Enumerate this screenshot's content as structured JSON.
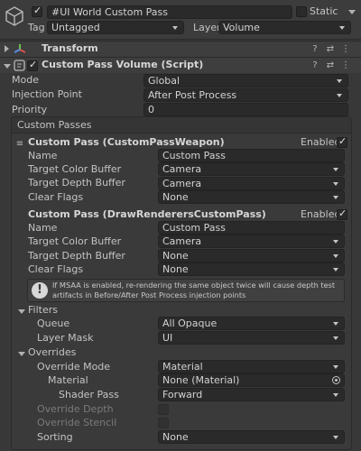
{
  "header": {
    "object_name": "#UI World Custom Pass",
    "static_label": "Static",
    "tag_label": "Tag",
    "tag_value": "Untagged",
    "layer_label": "Layer",
    "layer_value": "Volume"
  },
  "transform": {
    "title": "Transform"
  },
  "component": {
    "title": "Custom Pass Volume (Script)",
    "mode_label": "Mode",
    "mode_value": "Global",
    "injection_label": "Injection Point",
    "injection_value": "After Post Process",
    "priority_label": "Priority",
    "priority_value": "0",
    "custom_passes_label": "Custom Passes"
  },
  "pass1": {
    "title": "Custom Pass (CustomPassWeapon)",
    "enabled_label": "Enabled",
    "name_label": "Name",
    "name_value": "Custom Pass",
    "color_label": "Target Color Buffer",
    "color_value": "Camera",
    "depth_label": "Target Depth Buffer",
    "depth_value": "Camera",
    "clear_label": "Clear Flags",
    "clear_value": "None"
  },
  "pass2": {
    "title": "Custom Pass (DrawRenderersCustomPass)",
    "enabled_label": "Enabled",
    "name_label": "Name",
    "name_value": "Custom Pass",
    "color_label": "Target Color Buffer",
    "color_value": "Camera",
    "depth_label": "Target Depth Buffer",
    "depth_value": "None",
    "clear_label": "Clear Flags",
    "clear_value": "None",
    "info_line1": "If MSAA is enabled, re-rendering the same object twice will cause depth test",
    "info_line2": "artifacts in Before/After Post Process injection points",
    "filters_label": "Filters",
    "queue_label": "Queue",
    "queue_value": "All Opaque",
    "layer_mask_label": "Layer Mask",
    "layer_mask_value": "UI",
    "overrides_label": "Overrides",
    "override_mode_label": "Override Mode",
    "override_mode_value": "Material",
    "material_label": "Material",
    "material_value": "None (Material)",
    "shader_pass_label": "Shader Pass",
    "shader_pass_value": "Forward",
    "override_depth_label": "Override Depth",
    "override_stencil_label": "Override Stencil",
    "sorting_label": "Sorting",
    "sorting_value": "None"
  },
  "colors": {
    "background": "#383838",
    "field": "#2a2a2a",
    "text": "#c4c4c4"
  }
}
